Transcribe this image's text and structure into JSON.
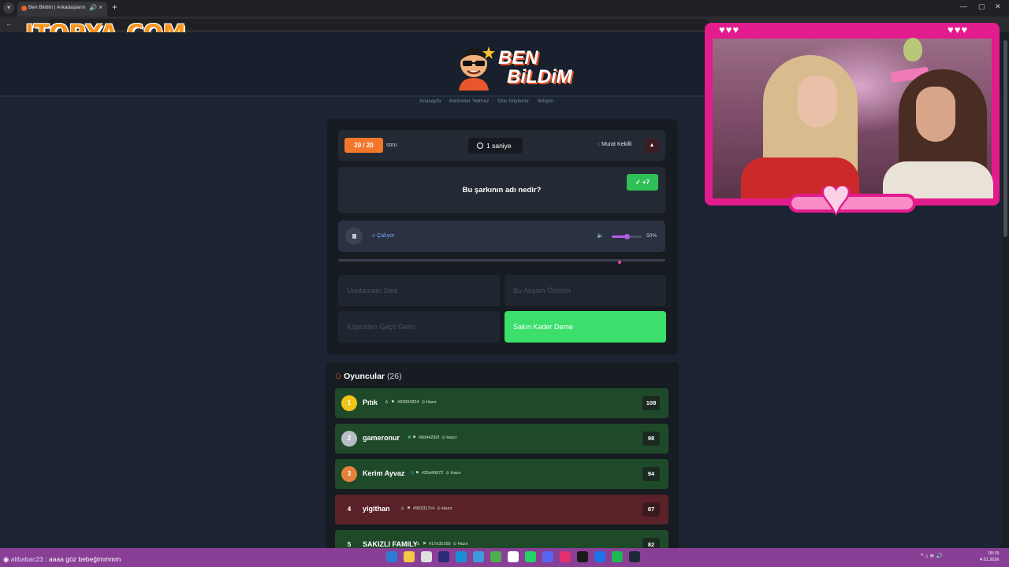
{
  "browser": {
    "tab_title": "Ben Bildim | Arkadaşlarınla",
    "tab_close": "×",
    "new_tab": "+",
    "audio_icon": "🔊",
    "window_controls": [
      "—",
      "▢",
      "✕"
    ]
  },
  "watermark": "ITOPYA.COM",
  "site": {
    "logo_line1": "BEN",
    "logo_line2": "BiLDiM",
    "nav": [
      "Anasayfa",
      "Kelimeler Yetmez",
      "Onu Söyleme",
      "İletişim"
    ]
  },
  "game": {
    "counter": "20 / 20",
    "counter_label": "soru",
    "timer": "1 saniye",
    "user": "Murat Kekilli",
    "alert_icon": "▲",
    "question": "Bu şarkının adı nedir?",
    "bonus": "✓ +7",
    "now_playing": "♫ Çalıyor",
    "volume_icon": "🔈",
    "volume": "50%",
    "volume_level": 0.5,
    "song_progress": 0.86,
    "answers": [
      {
        "label": "Unutamam Seni",
        "selected": false
      },
      {
        "label": "Bu Akşam Ölürüm",
        "selected": false
      },
      {
        "label": "Köprüden Geçti Gelin",
        "selected": false
      },
      {
        "label": "Sakın Kader Deme",
        "selected": true
      }
    ]
  },
  "players": {
    "title": "Oyuncular",
    "count": "(26)",
    "icon": "users-icon",
    "list": [
      {
        "rank": "1",
        "name": "Pıtık",
        "id": "#92804324",
        "status": "Hazır",
        "score": "108",
        "rank_color": "#f0c419",
        "row": "green"
      },
      {
        "rank": "2",
        "name": "gameronur",
        "id": "#8d44292f",
        "status": "Hazır",
        "score": "98",
        "rank_color": "#b8bcc4",
        "row": "green"
      },
      {
        "rank": "3",
        "name": "Kerim Ayvaz",
        "id": "#25d40872",
        "status": "Hazır",
        "score": "94",
        "rank_color": "#e5823a",
        "row": "green"
      },
      {
        "rank": "4",
        "name": "yigithan",
        "id": "#903317c4",
        "status": "Hazır",
        "score": "87",
        "rank_color": "transparent",
        "row": "red"
      },
      {
        "rank": "5",
        "name": "SAKIZLI FAMILY",
        "id": "#17e35168",
        "status": "Hazır",
        "score": "82",
        "rank_color": "transparent",
        "row": "green"
      }
    ]
  },
  "webcam": {
    "hearts": "♥♥♥",
    "big_heart": "♥"
  },
  "chat": {
    "user": "alibabac23",
    "message": ": aaaa göz bebeğimmmm"
  },
  "taskbar": {
    "tray": "^  ⌂  ≋  🔊",
    "time": "00:15",
    "date": "4.01.2026",
    "icon_colors": [
      "#2d7bd6",
      "#f5c842",
      "#e0e0e0",
      "#2b2b7a",
      "#1a8fd6",
      "#3c9ae0",
      "#4caf50",
      "#ffffff",
      "#25d366",
      "#5865f2",
      "#e1306c",
      "#1a1a1a",
      "#1a73e8",
      "#1db954",
      "#1b2838"
    ]
  },
  "colors": {
    "accent_orange": "#f2772a",
    "correct_green": "#3cde6c",
    "webcam_pink": "#e21c8d",
    "taskbar_purple": "#8a3f96"
  }
}
